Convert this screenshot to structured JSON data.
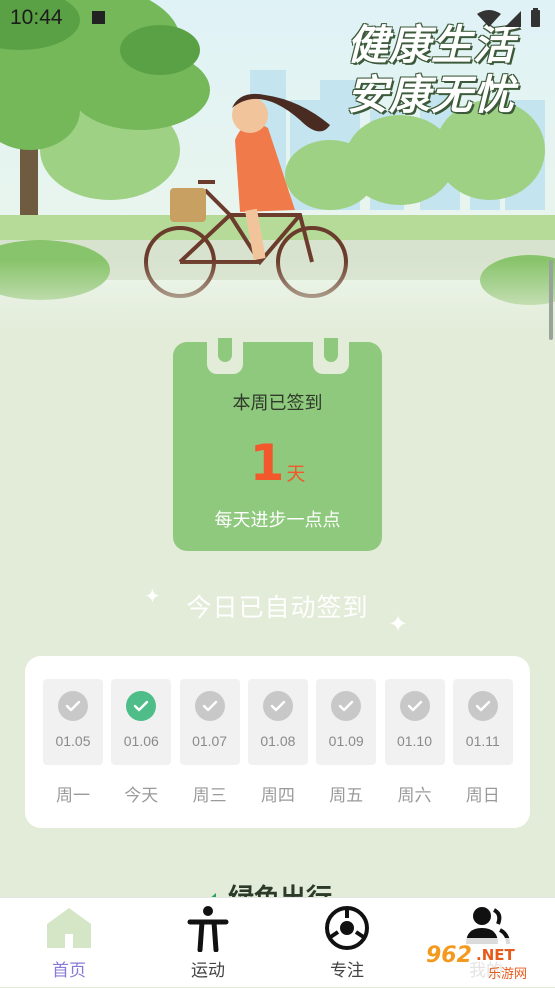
{
  "status_bar": {
    "time": "10:44"
  },
  "hero": {
    "title_line1": "健康生活",
    "title_line2": "安康无忧"
  },
  "checkin_card": {
    "label": "本周已签到",
    "count": "1",
    "unit": "天",
    "slogan": "每天进步一点点"
  },
  "auto_checkin_text": "今日已自动签到",
  "week": [
    {
      "date": "01.05",
      "day": "周一",
      "checked": false
    },
    {
      "date": "01.06",
      "day": "今天",
      "checked": true
    },
    {
      "date": "01.07",
      "day": "周三",
      "checked": false
    },
    {
      "date": "01.08",
      "day": "周四",
      "checked": false
    },
    {
      "date": "01.09",
      "day": "周五",
      "checked": false
    },
    {
      "date": "01.10",
      "day": "周六",
      "checked": false
    },
    {
      "date": "01.11",
      "day": "周日",
      "checked": false
    }
  ],
  "section_title": "绿色出行",
  "nav": {
    "home": "首页",
    "sport": "运动",
    "focus": "专注",
    "profile": "我的"
  },
  "watermark": {
    "brand": "962.NET",
    "sub": "乐游网"
  },
  "colors": {
    "accent": "#8fc97d",
    "highlight": "#f2582b",
    "check_on": "#4ebd88",
    "nav_active": "#8a7ad6"
  }
}
